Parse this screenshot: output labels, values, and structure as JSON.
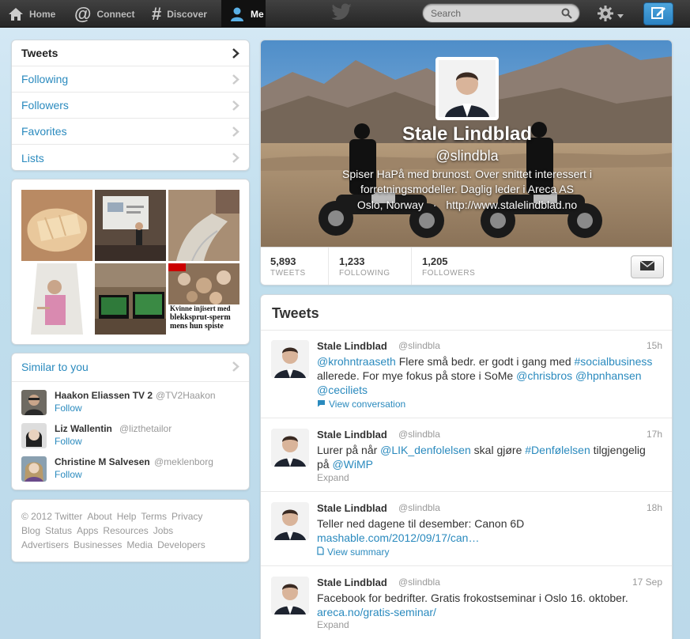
{
  "topnav": {
    "items": [
      {
        "label": "Home",
        "icon": "home-icon"
      },
      {
        "label": "Connect",
        "icon": "at-icon"
      },
      {
        "label": "Discover",
        "icon": "hash-icon"
      },
      {
        "label": "Me",
        "icon": "person-icon"
      }
    ],
    "search_placeholder": "Search"
  },
  "sidenav": {
    "items": [
      {
        "label": "Tweets"
      },
      {
        "label": "Following"
      },
      {
        "label": "Followers"
      },
      {
        "label": "Favorites"
      },
      {
        "label": "Lists"
      }
    ]
  },
  "photos": {
    "caption_line1": "Kvinne injisert med",
    "caption_line2": "blekksprut-sperm",
    "caption_line3": "mens hun spiste"
  },
  "similar": {
    "title": "Similar to you",
    "people": [
      {
        "name": "Haakon Eliassen TV 2",
        "handle": "@TV2Haakon",
        "follow": "Follow"
      },
      {
        "name": "Liz Wallentin",
        "handle": "@lizthetailor",
        "follow": "Follow"
      },
      {
        "name": "Christine M Salvesen",
        "handle": "@meklenborg",
        "follow": "Follow"
      }
    ]
  },
  "footer": {
    "line1": [
      "© 2012 Twitter",
      "About",
      "Help",
      "Terms",
      "Privacy"
    ],
    "line2": [
      "Blog",
      "Status",
      "Apps",
      "Resources",
      "Jobs"
    ],
    "line3": [
      "Advertisers",
      "Businesses",
      "Media",
      "Developers"
    ]
  },
  "profile": {
    "name": "Stale Lindblad",
    "handle": "@slindbla",
    "bio": "Spiser HaPå med brunost. Over snittet interessert i forretningsmodeller. Daglig leder i Areca AS",
    "location": "Oslo, Norway",
    "separator": "·",
    "url": "http://www.stalelindblad.no",
    "stats": [
      {
        "value": "5,893",
        "label": "TWEETS"
      },
      {
        "value": "1,233",
        "label": "FOLLOWING"
      },
      {
        "value": "1,205",
        "label": "FOLLOWERS"
      }
    ]
  },
  "tweets": {
    "title": "Tweets",
    "items": [
      {
        "name": "Stale Lindblad",
        "handle": "@slindbla",
        "time": "15h",
        "line1_a": "@krohntraaseth",
        "line1_b": " Flere små bedr. er godt i gang med ",
        "line1_c": "#socialbusiness",
        "line2_a": "allerede. For mye fokus på store i SoMe ",
        "line2_b": "@chrisbros",
        "line2_c": " ",
        "line2_d": "@hpnhansen",
        "line3_a": "@ceciliets",
        "meta": "View conversation"
      },
      {
        "name": "Stale Lindblad",
        "handle": "@slindbla",
        "time": "17h",
        "line1_a": "Lurer på når ",
        "line1_b": "@LIK_denfolelsen",
        "line1_c": " skal gjøre ",
        "line1_d": "#Denfølelsen",
        "line1_e": " tilgjengelig",
        "line2_a": "på ",
        "line2_b": "@WiMP",
        "meta": "Expand"
      },
      {
        "name": "Stale Lindblad",
        "handle": "@slindbla",
        "time": "18h",
        "line1_a": "Teller ned dagene til desember: Canon 6D",
        "line2_a": "mashable.com/2012/09/17/can…",
        "meta": "View summary"
      },
      {
        "name": "Stale Lindblad",
        "handle": "@slindbla",
        "time": "17 Sep",
        "line1_a": "Facebook for bedrifter. Gratis frokostseminar i Oslo 16. oktober.",
        "line2_a": "areca.no/gratis-seminar/",
        "meta": "Expand"
      }
    ]
  }
}
